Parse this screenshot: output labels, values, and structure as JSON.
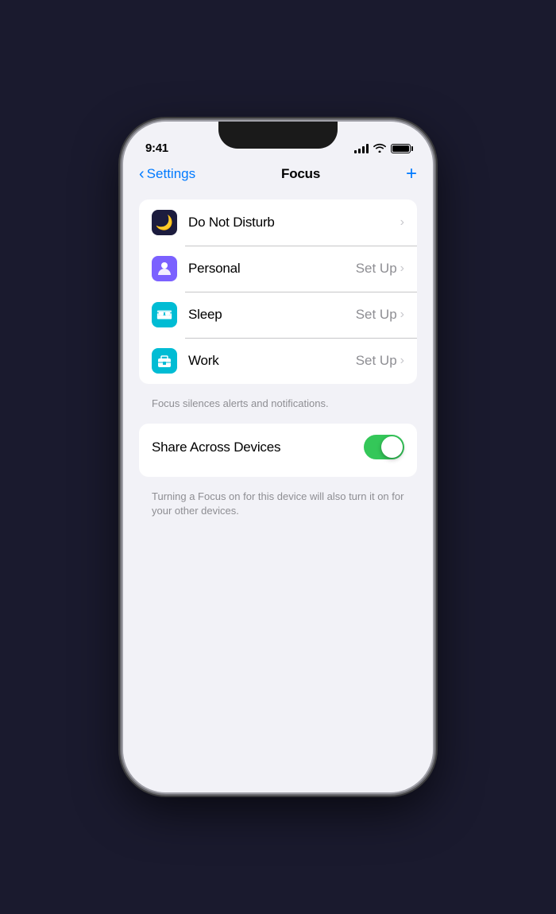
{
  "status_bar": {
    "time": "9:41",
    "signal_bars": [
      4,
      6,
      8,
      10,
      12
    ],
    "wifi": "wifi",
    "battery_level": 90
  },
  "nav": {
    "back_label": "Settings",
    "title": "Focus",
    "add_label": "+"
  },
  "focus_items": [
    {
      "id": "do-not-disturb",
      "label": "Do Not Disturb",
      "icon_type": "moon",
      "action": "",
      "has_setup": false
    },
    {
      "id": "personal",
      "label": "Personal",
      "icon_type": "person",
      "action": "Set Up",
      "has_setup": true
    },
    {
      "id": "sleep",
      "label": "Sleep",
      "icon_type": "bed",
      "action": "Set Up",
      "has_setup": true
    },
    {
      "id": "work",
      "label": "Work",
      "icon_type": "briefcase",
      "action": "Set Up",
      "has_setup": true
    }
  ],
  "helper_text": "Focus silences alerts and notifications.",
  "share_across_devices": {
    "label": "Share Across Devices",
    "enabled": true
  },
  "share_helper_text": "Turning a Focus on for this device will also turn it on for your other devices."
}
